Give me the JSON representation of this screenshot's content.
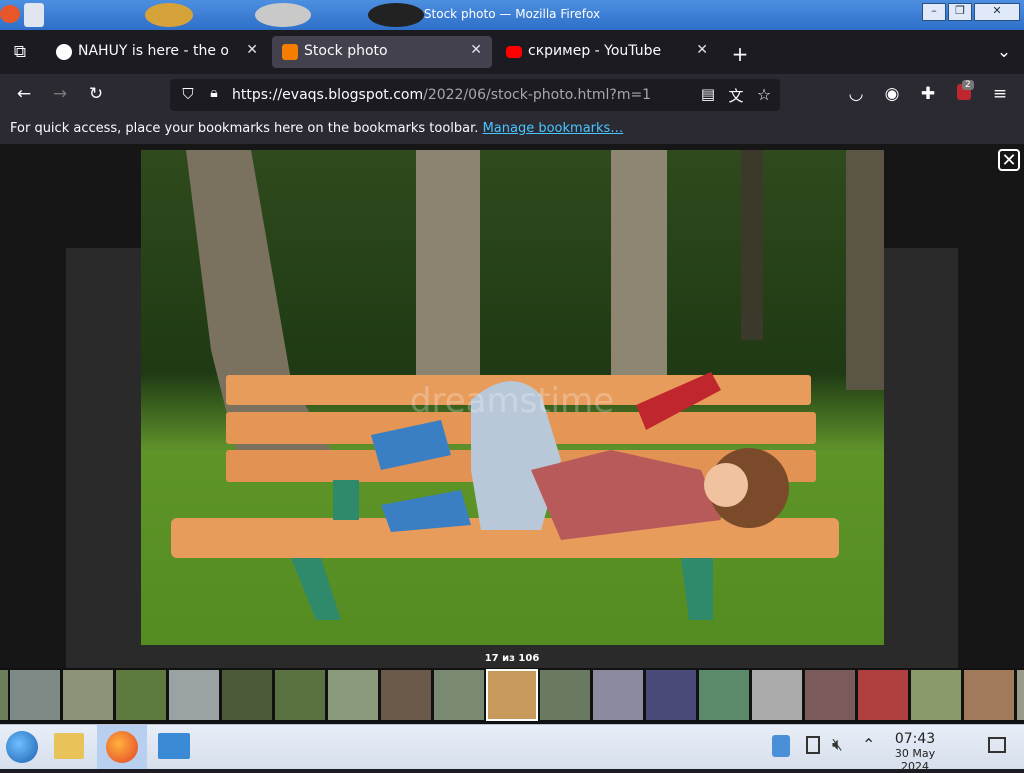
{
  "window": {
    "title": "Stock photo — Mozilla Firefox"
  },
  "tabs": [
    {
      "label": "NAHUY is here - the offici",
      "active": false
    },
    {
      "label": "Stock photo",
      "active": true
    },
    {
      "label": "скример - YouTube",
      "active": false
    }
  ],
  "urlbar": {
    "host": "https://evaqs.blogspot.com",
    "path": "/2022/06/stock-photo.html?m=1"
  },
  "toolbar": {
    "extension_badge": "2"
  },
  "bookmarks_bar": {
    "message": "For quick access, place your bookmarks here on the bookmarks toolbar.",
    "link": "Manage bookmarks…"
  },
  "lightbox": {
    "counter": "17 из 106",
    "watermark": "dreamstime"
  },
  "taskbar": {
    "time": "07:43",
    "date": "30 May 2024"
  },
  "colors": {
    "tab_active": "#42414d",
    "link": "#47c6ff",
    "bench": "#e89c5c"
  }
}
